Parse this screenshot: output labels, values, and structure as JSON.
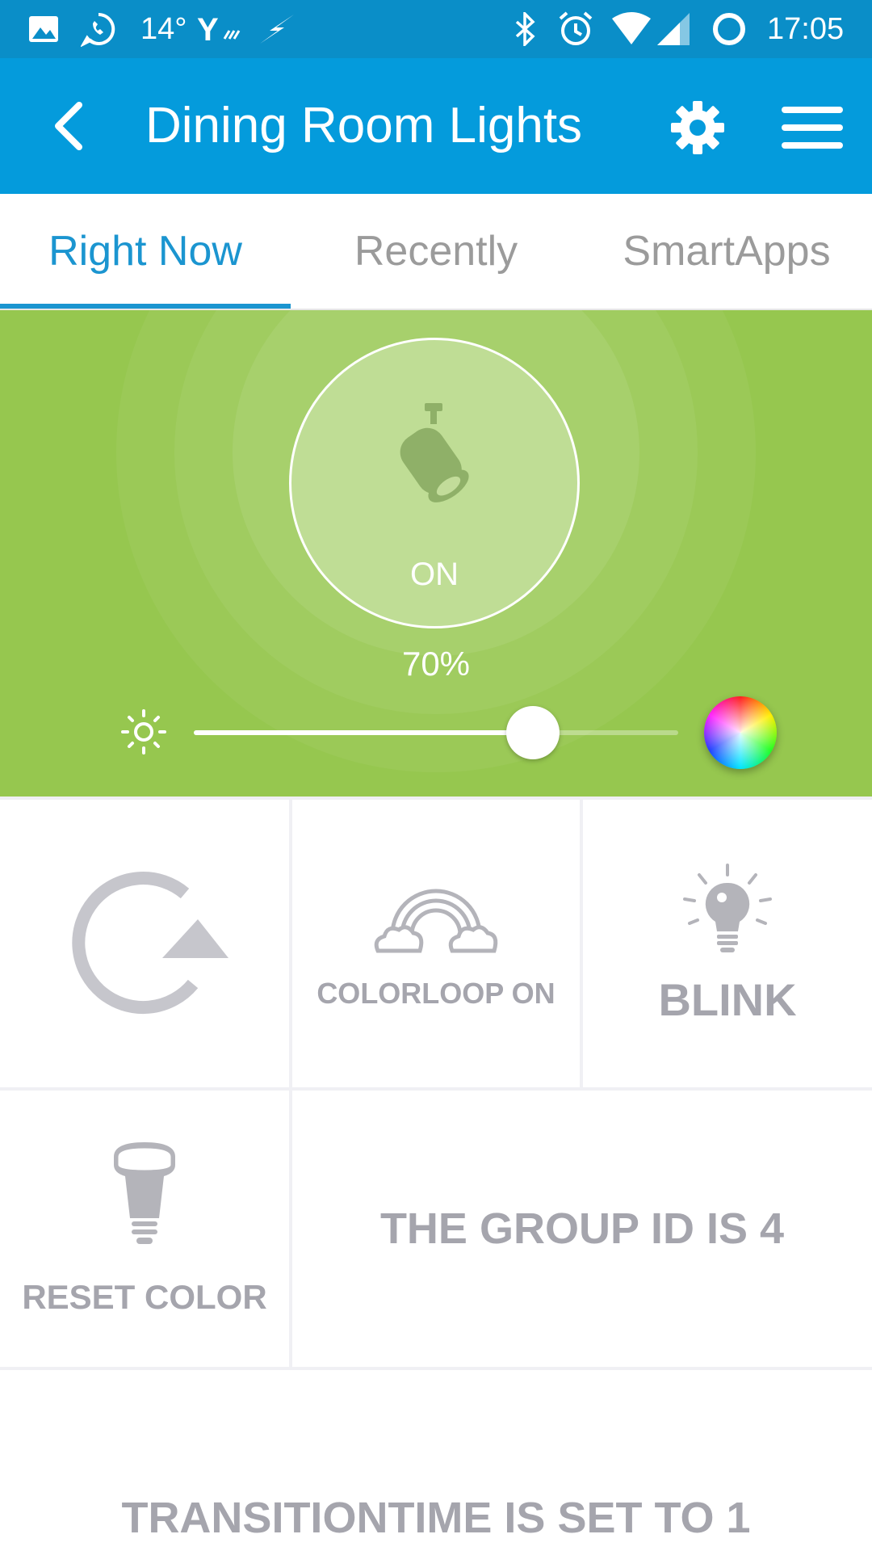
{
  "status_bar": {
    "temperature": "14°",
    "time": "17:05"
  },
  "app_bar": {
    "title": "Dining Room Lights"
  },
  "tabs": [
    {
      "label": "Right Now",
      "active": true
    },
    {
      "label": "Recently",
      "active": false
    },
    {
      "label": "SmartApps",
      "active": false
    }
  ],
  "device": {
    "state": "ON",
    "brightness_label": "70%",
    "brightness_value": 0.7
  },
  "tiles": {
    "refresh": {
      "icon": "refresh-icon"
    },
    "colorloop": {
      "label": "COLORLOOP ON",
      "icon": "rainbow-icon"
    },
    "blink": {
      "label": "BLINK",
      "icon": "lightbulb-on-icon"
    },
    "reset_color": {
      "label": "RESET COLOR",
      "icon": "bulb-icon"
    },
    "group_id": {
      "label": "THE GROUP ID IS 4"
    },
    "transition": {
      "label": "TRANSITIONTIME IS SET TO 1"
    }
  },
  "colors": {
    "status_bar": "#0a8ec8",
    "app_bar": "#049bdc",
    "accent": "#1b95d0",
    "hero": "#96c74f",
    "tile_text": "#a5a5ad"
  }
}
